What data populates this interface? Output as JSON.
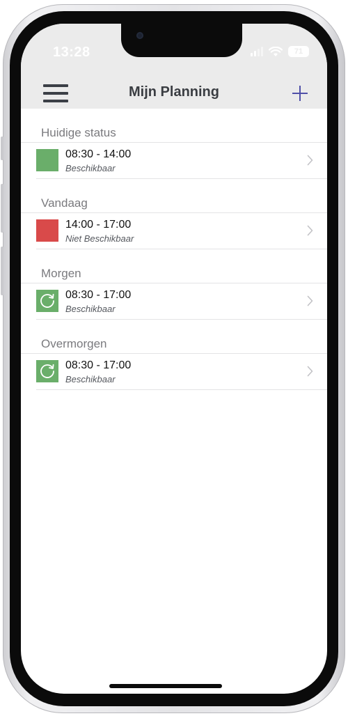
{
  "status_bar": {
    "time": "13:28",
    "battery_level": "71",
    "icons": [
      "signal-icon",
      "wifi-icon",
      "battery-icon"
    ]
  },
  "nav": {
    "title": "Mijn Planning",
    "menu_icon": "hamburger-menu-icon",
    "add_icon": "plus-icon"
  },
  "colors": {
    "available": "#6aae6a",
    "unavailable": "#d94a4a",
    "accent": "#4f4fa8"
  },
  "sections": [
    {
      "title": "Huidige status",
      "entry": {
        "time": "08:30 - 14:00",
        "status": "Beschikbaar",
        "indicator": "solid-green"
      }
    },
    {
      "title": "Vandaag",
      "entry": {
        "time": "14:00 - 17:00",
        "status": "Niet Beschikbaar",
        "indicator": "solid-red"
      }
    },
    {
      "title": "Morgen",
      "entry": {
        "time": "08:30 - 17:00",
        "status": "Beschikbaar",
        "indicator": "repeat-icon-green"
      }
    },
    {
      "title": "Overmorgen",
      "entry": {
        "time": "08:30 - 17:00",
        "status": "Beschikbaar",
        "indicator": "repeat-icon-green"
      }
    }
  ]
}
